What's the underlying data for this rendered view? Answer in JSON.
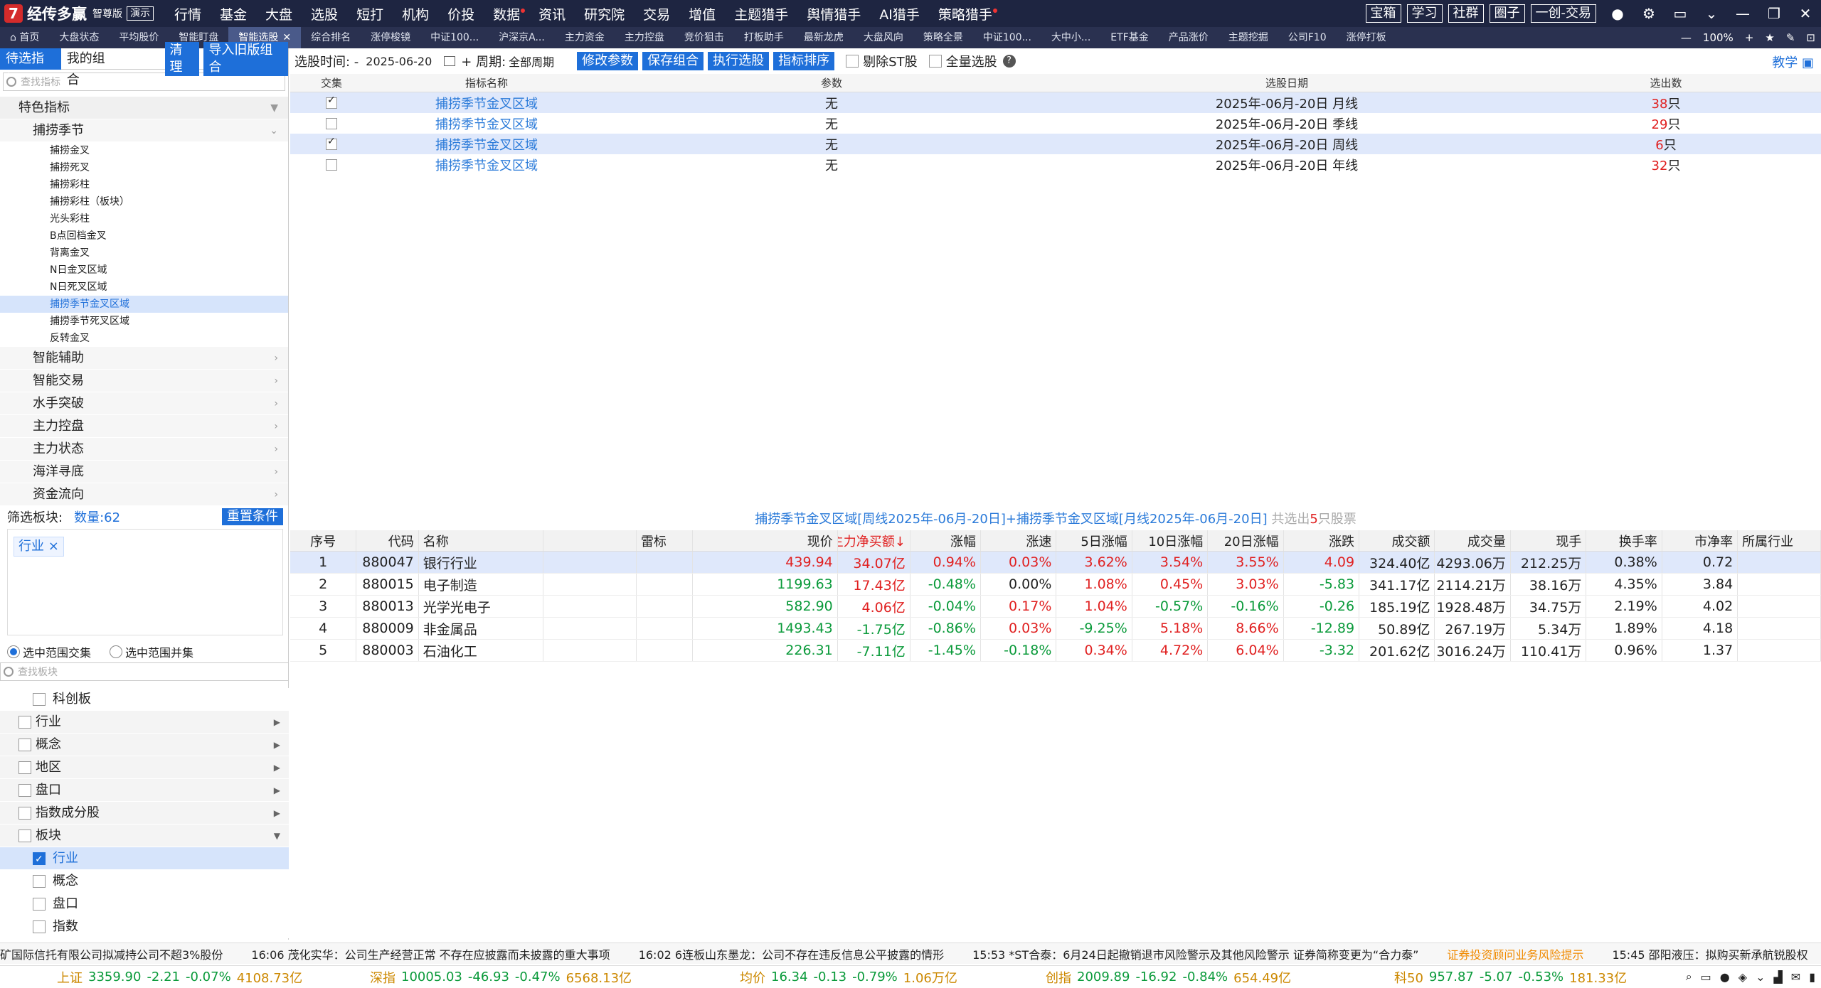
{
  "app": {
    "name": "经传多赢",
    "edition": "智尊版",
    "demo": "演示",
    "logo_char": "7"
  },
  "menu": [
    {
      "label": "行情",
      "dot": false
    },
    {
      "label": "基金",
      "dot": false
    },
    {
      "label": "大盘",
      "dot": false
    },
    {
      "label": "选股",
      "dot": false
    },
    {
      "label": "短打",
      "dot": false
    },
    {
      "label": "机构",
      "dot": false
    },
    {
      "label": "价投",
      "dot": false
    },
    {
      "label": "数据",
      "dot": true
    },
    {
      "label": "资讯",
      "dot": false
    },
    {
      "label": "研究院",
      "dot": false
    },
    {
      "label": "交易",
      "dot": false
    },
    {
      "label": "增值",
      "dot": false
    },
    {
      "label": "主题猎手",
      "dot": false
    },
    {
      "label": "舆情猎手",
      "dot": false
    },
    {
      "label": "AI猎手",
      "dot": false
    },
    {
      "label": "策略猎手",
      "dot": true
    }
  ],
  "top_buttons": [
    "宝箱",
    "学习",
    "社群",
    "圈子",
    "一创-交易"
  ],
  "tabs": [
    {
      "label": "首页",
      "active": false
    },
    {
      "label": "大盘状态",
      "active": false
    },
    {
      "label": "平均股价",
      "active": false
    },
    {
      "label": "智能盯盘",
      "active": false
    },
    {
      "label": "智能选股",
      "active": true
    },
    {
      "label": "综合排名",
      "active": false
    },
    {
      "label": "涨停梭镜",
      "active": false
    },
    {
      "label": "中证100...",
      "active": false
    },
    {
      "label": "沪深京A...",
      "active": false
    },
    {
      "label": "主力资金",
      "active": false
    },
    {
      "label": "主力控盘",
      "active": false
    },
    {
      "label": "竞价狙击",
      "active": false
    },
    {
      "label": "打板助手",
      "active": false
    },
    {
      "label": "最新龙虎",
      "active": false
    },
    {
      "label": "大盘风向",
      "active": false
    },
    {
      "label": "策略全景",
      "active": false
    },
    {
      "label": "中证100...",
      "active": false
    },
    {
      "label": "大中小...",
      "active": false
    },
    {
      "label": "ETF基金",
      "active": false
    },
    {
      "label": "产品涨价",
      "active": false
    },
    {
      "label": "主题挖掘",
      "active": false
    },
    {
      "label": "公司F10",
      "active": false
    },
    {
      "label": "涨停打板",
      "active": false
    }
  ],
  "zoom": "100%",
  "left": {
    "tab_pending": "待选指标",
    "tab_mine": "我的组合",
    "btn_clear": "清理",
    "btn_import": "导入旧版组合",
    "search_placeholder": "查找指标",
    "group_special": "特色指标",
    "subgroup": "捕捞季节",
    "items": [
      {
        "label": "捕捞金叉",
        "sel": false
      },
      {
        "label": "捕捞死叉",
        "sel": false
      },
      {
        "label": "捕捞彩柱",
        "sel": false
      },
      {
        "label": "捕捞彩柱（板块）",
        "sel": false
      },
      {
        "label": "光头彩柱",
        "sel": false
      },
      {
        "label": "B点回档金叉",
        "sel": false
      },
      {
        "label": "背离金叉",
        "sel": false
      },
      {
        "label": "N日金叉区域",
        "sel": false
      },
      {
        "label": "N日死叉区域",
        "sel": false
      },
      {
        "label": "捕捞季节金叉区域",
        "sel": true
      },
      {
        "label": "捕捞季节死叉区域",
        "sel": false
      },
      {
        "label": "反转金叉",
        "sel": false
      }
    ],
    "groups": [
      "智能辅助",
      "智能交易",
      "水手突破",
      "主力控盘",
      "主力状态",
      "海洋寻底",
      "资金流向"
    ],
    "filter_label": "筛选板块:",
    "filter_count": "数量:62",
    "btn_reset": "重置条件",
    "chip": "行业 ×",
    "radio_intersect": "选中范围交集",
    "radio_union": "选中范围并集",
    "search2_placeholder": "查找板块",
    "board_tree": [
      {
        "label": "科创板",
        "level": "sub",
        "checked": false,
        "sel": false,
        "tri": ""
      },
      {
        "label": "行业",
        "level": "top",
        "checked": false,
        "sel": false,
        "tri": "▶"
      },
      {
        "label": "概念",
        "level": "top",
        "checked": false,
        "sel": false,
        "tri": "▶"
      },
      {
        "label": "地区",
        "level": "top",
        "checked": false,
        "sel": false,
        "tri": "▶"
      },
      {
        "label": "盘口",
        "level": "top",
        "checked": false,
        "sel": false,
        "tri": "▶"
      },
      {
        "label": "指数成分股",
        "level": "top",
        "checked": false,
        "sel": false,
        "tri": "▶"
      },
      {
        "label": "板块",
        "level": "top",
        "checked": false,
        "sel": false,
        "tri": "▼"
      },
      {
        "label": "行业",
        "level": "sub",
        "checked": true,
        "sel": true,
        "tri": ""
      },
      {
        "label": "概念",
        "level": "sub",
        "checked": false,
        "sel": false,
        "tri": ""
      },
      {
        "label": "盘口",
        "level": "sub",
        "checked": false,
        "sel": false,
        "tri": ""
      },
      {
        "label": "指数",
        "level": "sub",
        "checked": false,
        "sel": false,
        "tri": ""
      }
    ]
  },
  "toolbar": {
    "date_label": "选股时间: -",
    "date_value": "2025-06-20",
    "period_label": "+ 周期:",
    "period_value": "全部周期",
    "btn_modify": "修改参数",
    "btn_save": "保存组合",
    "btn_exec": "执行选股",
    "btn_sort": "指标排序",
    "exclude_st": "剔除ST股",
    "full_select": "全量选股",
    "help": "?",
    "teach": "教学"
  },
  "indicator_table": {
    "headers": {
      "jj": "交集",
      "name": "指标名称",
      "param": "参数",
      "date": "选股日期",
      "num": "选出数"
    },
    "rows": [
      {
        "checked": true,
        "name": "捕捞季节金叉区域",
        "param": "无",
        "date": "2025年-06月-20日 月线",
        "num": "38",
        "unit": "只",
        "sel": true
      },
      {
        "checked": false,
        "name": "捕捞季节金叉区域",
        "param": "无",
        "date": "2025年-06月-20日 季线",
        "num": "29",
        "unit": "只",
        "sel": false
      },
      {
        "checked": true,
        "name": "捕捞季节金叉区域",
        "param": "无",
        "date": "2025年-06月-20日 周线",
        "num": "6",
        "unit": "只",
        "sel": true
      },
      {
        "checked": false,
        "name": "捕捞季节金叉区域",
        "param": "无",
        "date": "2025年-06月-20日 年线",
        "num": "32",
        "unit": "只",
        "sel": false
      }
    ]
  },
  "result_title": {
    "main": "捕捞季节金叉区域[周线2025年-06月-20日]+捕捞季节金叉区域[月线2025年-06月-20日]",
    "pre": " 共选出",
    "count": "5",
    "post": "只股票"
  },
  "result_table": {
    "headers": [
      "序号",
      "代码",
      "名称",
      "",
      "雷标",
      "现价",
      "主力净买额↓",
      "涨幅",
      "涨速",
      "5日涨幅",
      "10日涨幅",
      "20日涨幅",
      "涨跌",
      "成交额",
      "成交量",
      "现手",
      "换手率",
      "市净率",
      "所属行业"
    ],
    "rows": [
      {
        "sel": true,
        "cells": [
          "1",
          "880047",
          "银行行业",
          "",
          "",
          "439.94",
          "34.07亿",
          "0.94%",
          "0.03%",
          "3.62%",
          "3.54%",
          "3.55%",
          "4.09",
          "324.40亿",
          "4293.06万",
          "212.25万",
          "0.38%",
          "0.72",
          ""
        ],
        "colors": [
          "blk",
          "blk",
          "blk",
          "blk",
          "blk",
          "red",
          "red",
          "red",
          "red",
          "red",
          "red",
          "red",
          "red",
          "blk",
          "blk",
          "blk",
          "blk",
          "blk",
          "blk"
        ]
      },
      {
        "sel": false,
        "cells": [
          "2",
          "880015",
          "电子制造",
          "",
          "",
          "1199.63",
          "17.43亿",
          "-0.48%",
          "0.00%",
          "1.08%",
          "0.45%",
          "3.03%",
          "-5.83",
          "341.17亿",
          "2114.21万",
          "38.16万",
          "4.35%",
          "3.84",
          ""
        ],
        "colors": [
          "blk",
          "blk",
          "blk",
          "blk",
          "blk",
          "grn",
          "red",
          "grn",
          "blk",
          "red",
          "red",
          "red",
          "grn",
          "blk",
          "blk",
          "blk",
          "blk",
          "blk",
          "blk"
        ]
      },
      {
        "sel": false,
        "cells": [
          "3",
          "880013",
          "光学光电子",
          "",
          "",
          "582.90",
          "4.06亿",
          "-0.04%",
          "0.17%",
          "1.04%",
          "-0.57%",
          "-0.16%",
          "-0.26",
          "185.19亿",
          "1928.48万",
          "34.75万",
          "2.19%",
          "4.02",
          ""
        ],
        "colors": [
          "blk",
          "blk",
          "blk",
          "blk",
          "blk",
          "grn",
          "red",
          "grn",
          "red",
          "red",
          "grn",
          "grn",
          "grn",
          "blk",
          "blk",
          "blk",
          "blk",
          "blk",
          "blk"
        ]
      },
      {
        "sel": false,
        "cells": [
          "4",
          "880009",
          "非金属品",
          "",
          "",
          "1493.43",
          "-1.75亿",
          "-0.86%",
          "0.03%",
          "-9.25%",
          "5.18%",
          "8.66%",
          "-12.89",
          "50.89亿",
          "267.19万",
          "5.34万",
          "1.89%",
          "4.18",
          ""
        ],
        "colors": [
          "blk",
          "blk",
          "blk",
          "blk",
          "blk",
          "grn",
          "grn",
          "grn",
          "red",
          "grn",
          "red",
          "red",
          "grn",
          "blk",
          "blk",
          "blk",
          "blk",
          "blk",
          "blk"
        ]
      },
      {
        "sel": false,
        "cells": [
          "5",
          "880003",
          "石油化工",
          "",
          "",
          "226.31",
          "-7.11亿",
          "-1.45%",
          "-0.18%",
          "0.34%",
          "4.72%",
          "6.04%",
          "-3.32",
          "201.62亿",
          "3016.24万",
          "110.41万",
          "0.96%",
          "1.37",
          ""
        ],
        "colors": [
          "blk",
          "blk",
          "blk",
          "blk",
          "blk",
          "grn",
          "grn",
          "grn",
          "grn",
          "red",
          "red",
          "red",
          "grn",
          "blk",
          "blk",
          "blk",
          "blk",
          "blk",
          "blk"
        ]
      }
    ]
  },
  "news": [
    {
      "text": "矿国际信托有限公司拟减持公司不超3%股份",
      "org": false
    },
    {
      "text": "16:06 茂化实华：公司生产经营正常 不存在应披露而未披露的重大事项",
      "org": false
    },
    {
      "text": "16:02 6连板山东墨龙：公司不存在违反信息公平披露的情形",
      "org": false
    },
    {
      "text": "15:53 *ST合泰：6月24日起撤销退市风险警示及其他风险警示 证券简称变更为“合力泰”",
      "org": false
    },
    {
      "text": "证券投资顾问业务风险提示",
      "org": true
    },
    {
      "text": "15:45 邵阳液压：拟购买新承航锐股权",
      "org": false
    }
  ],
  "indices": [
    {
      "name": "上证",
      "value": "3359.90",
      "chg": "-2.21",
      "pct": "-0.07%",
      "amt": "4108.73亿"
    },
    {
      "name": "深指",
      "value": "10005.03",
      "chg": "-46.93",
      "pct": "-0.47%",
      "amt": "6568.13亿"
    },
    {
      "name": "均价",
      "value": "16.34",
      "chg": "-0.13",
      "pct": "-0.79%",
      "amt": "1.06万亿"
    },
    {
      "name": "创指",
      "value": "2009.89",
      "chg": "-16.92",
      "pct": "-0.84%",
      "amt": "654.49亿"
    },
    {
      "name": "科50",
      "value": "957.87",
      "chg": "-5.07",
      "pct": "-0.53%",
      "amt": "181.33亿"
    }
  ]
}
